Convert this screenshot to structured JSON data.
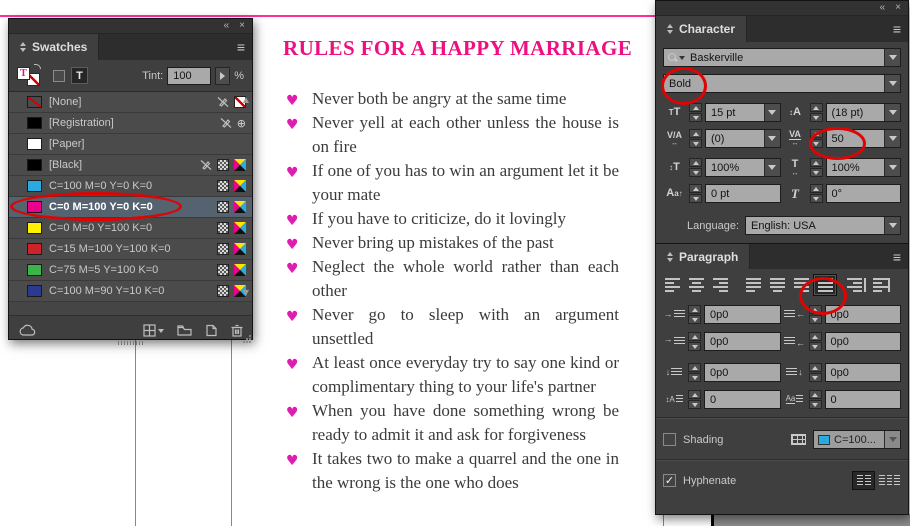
{
  "colors": {
    "title_magenta": "#ee1080",
    "heart_pink": "#e21cb0",
    "annotation_red": "#de0404",
    "guide_pink": "#ff2f9e",
    "guide_purple": "#a767d8",
    "selected_row_blue": "#556270",
    "shading_swatch_cyan": "#29abe2"
  },
  "swatches_panel": {
    "title": "Swatches",
    "tint_label": "Tint:",
    "tint_value": "100",
    "tint_unit": "%",
    "rows": [
      {
        "name": "[None]",
        "chip": "#ffffff"
      },
      {
        "name": "[Registration]",
        "chip": "#000000"
      },
      {
        "name": "[Paper]",
        "chip": "#ffffff"
      },
      {
        "name": "[Black]",
        "chip": "#000000"
      },
      {
        "name": "C=100 M=0 Y=0 K=0",
        "chip": "#29abe2"
      },
      {
        "name": "C=0 M=100 Y=0 K=0",
        "chip": "#ec008c",
        "selected": true
      },
      {
        "name": "C=0 M=0 Y=100 K=0",
        "chip": "#fff200"
      },
      {
        "name": "C=15 M=100 Y=100 K=0",
        "chip": "#cc2229"
      },
      {
        "name": "C=75 M=5 Y=100 K=0",
        "chip": "#3ab54a"
      },
      {
        "name": "C=100 M=90 Y=10 K=0",
        "chip": "#2b3990"
      }
    ]
  },
  "document": {
    "title": "RULES FOR A HAPPY MARRIAGE",
    "bullet_icon": "heart",
    "items": [
      "Never both be angry at the same time",
      "Never yell at each other unless the house is on fire",
      "If one of you has to win an argument let it be your mate",
      "If you have to criticize, do it lovingly",
      "Never bring up mistakes of the past",
      "Neglect the whole world rather than each other",
      "Never go to sleep with an argument unsettled",
      "At least once everyday try to say one kind or complimentary thing to your life's partner",
      "When you have done something wrong be ready to admit it and ask for forgiveness",
      "It takes two to make a quarrel and the one in the wrong is the one who does"
    ]
  },
  "character_panel": {
    "title": "Character",
    "font_name": "Baskerville",
    "font_style": "Bold",
    "font_size": "15 pt",
    "leading": "(18 pt)",
    "kerning": "(0)",
    "tracking": "50",
    "vertical_scale": "100%",
    "horizontal_scale": "100%",
    "baseline_shift": "0 pt",
    "skew": "0°",
    "language_label": "Language:",
    "language_value": "English: USA"
  },
  "paragraph_panel": {
    "title": "Paragraph",
    "left_indent": "0p0",
    "right_indent": "0p0",
    "first_line_indent": "0p0",
    "last_line_right_indent": "0p0",
    "space_before": "0p0",
    "space_after": "0p0",
    "drop_cap_lines": "0",
    "drop_cap_characters": "0",
    "shading_label": "Shading",
    "shading_swatch": "C=100...",
    "hyphenate_label": "Hyphenate",
    "selected_alignment": "justify-all"
  }
}
